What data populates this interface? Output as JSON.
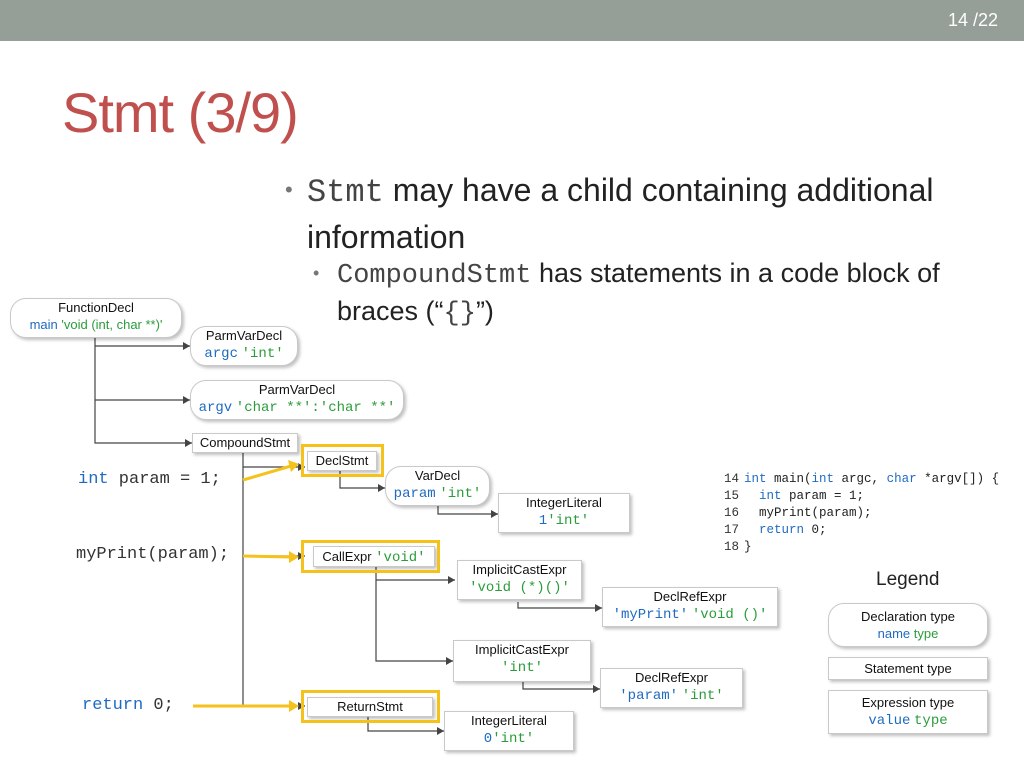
{
  "header": {
    "page": "14 /22"
  },
  "title": "Stmt (3/9)",
  "bullets": {
    "b1_code": "Stmt",
    "b1_text": " may have a child containing additional information",
    "b2_code": "CompoundStmt",
    "b2_text": " has statements in a code block of braces (“",
    "b2_braces": "{}",
    "b2_end": "”)"
  },
  "tree": {
    "function_decl": {
      "kind": "FunctionDecl",
      "name": "main",
      "type": "'void (int, char **)'"
    },
    "parm1": {
      "kind": "ParmVarDecl",
      "name": "argc",
      "type": "'int'"
    },
    "parm2": {
      "kind": "ParmVarDecl",
      "name": "argv",
      "type": "'char **':'char **'"
    },
    "compound": {
      "kind": "CompoundStmt"
    },
    "declstmt": {
      "kind": "DeclStmt"
    },
    "vardecl": {
      "kind": "VarDecl",
      "name": "param",
      "type": "'int'"
    },
    "intlit1": {
      "kind": "IntegerLiteral",
      "name": "1",
      "type": "'int'"
    },
    "callexpr": {
      "kind": "CallExpr",
      "type": "'void'"
    },
    "ice1": {
      "kind": "ImplicitCastExpr",
      "type": "'void (*)()'"
    },
    "dre1": {
      "kind": "DeclRefExpr",
      "name": "'myPrint'",
      "type": "'void ()'"
    },
    "ice2": {
      "kind": "ImplicitCastExpr",
      "type": "'int'"
    },
    "dre2": {
      "kind": "DeclRefExpr",
      "name": "'param'",
      "type": "'int'"
    },
    "returnstmt": {
      "kind": "ReturnStmt"
    },
    "intlit2": {
      "kind": "IntegerLiteral",
      "name": "0",
      "type": "'int'"
    }
  },
  "source_labels": {
    "line1_kw": "int",
    "line1_rest": " param = 1;",
    "line2": "myPrint(param);",
    "line3_kw": "return",
    "line3_rest": " 0;"
  },
  "code": [
    {
      "num": "14",
      "text": "int main(int argc, char *argv[]) {"
    },
    {
      "num": "15",
      "text": "  int param = 1;"
    },
    {
      "num": "16",
      "text": "  myPrint(param);"
    },
    {
      "num": "17",
      "text": "  return 0;"
    },
    {
      "num": "18",
      "text": "}"
    }
  ],
  "legend": {
    "title": "Legend",
    "decl_label": "Declaration type",
    "decl_name": "name",
    "decl_type": "type",
    "stmt_label": "Statement type",
    "expr_label": "Expression type",
    "expr_name": "value",
    "expr_type": "type"
  },
  "colors": {
    "title": "#c0504d",
    "name": "#1f6bc1",
    "type": "#2a9d3a",
    "highlight": "#f5c21b",
    "topbar": "#959e97"
  }
}
